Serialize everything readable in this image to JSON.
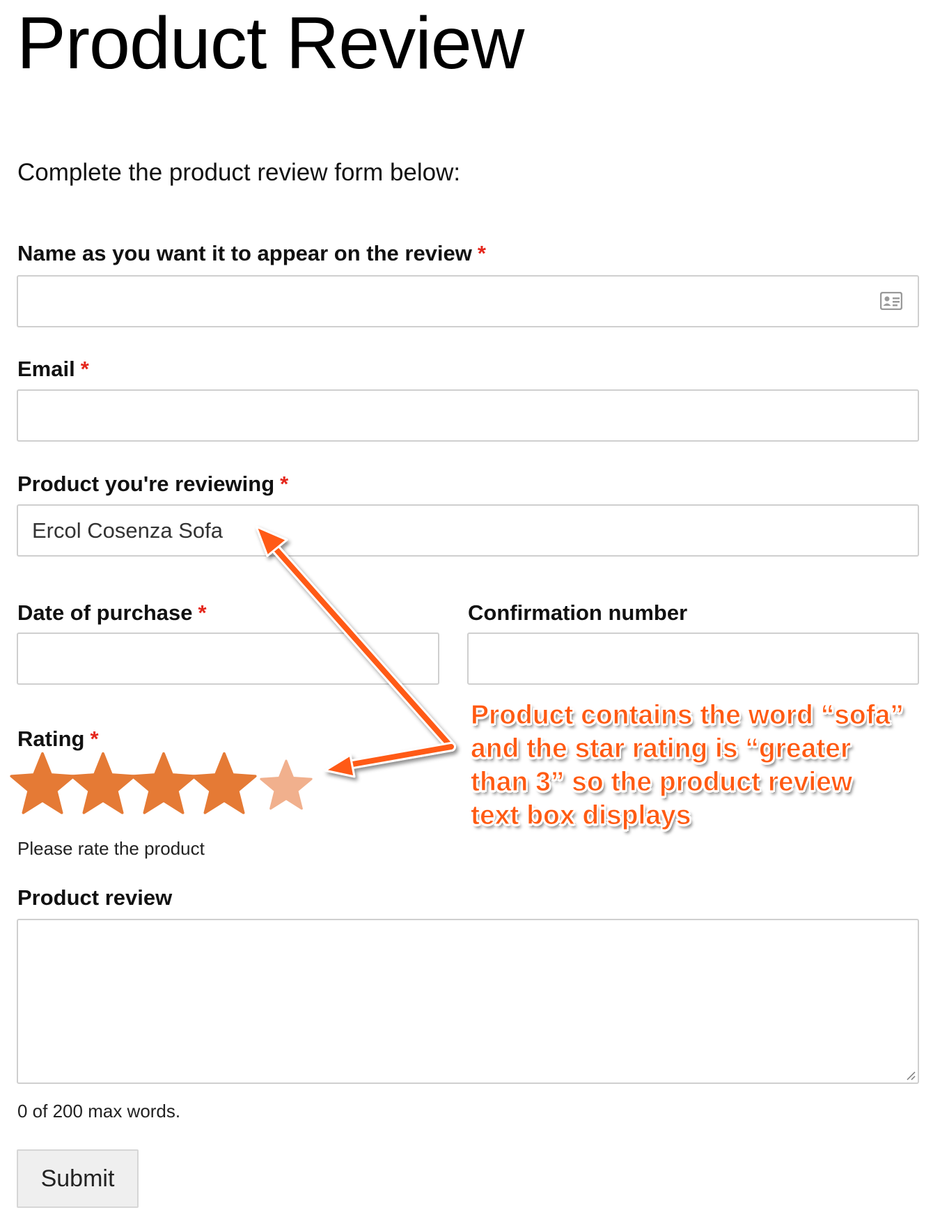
{
  "page": {
    "title": "Product Review",
    "intro": "Complete the product review form below:"
  },
  "form": {
    "required_marker": "*",
    "name": {
      "label": "Name as you want it to appear on the review",
      "value": "",
      "icon": "contact-card-icon"
    },
    "email": {
      "label": "Email",
      "value": ""
    },
    "product": {
      "label": "Product you're reviewing",
      "value": "Ercol Cosenza Sofa"
    },
    "date_of_purchase": {
      "label": "Date of purchase",
      "value": ""
    },
    "confirmation_number": {
      "label": "Confirmation number",
      "value": ""
    },
    "rating": {
      "label": "Rating",
      "selected": 4,
      "max": 5,
      "hint": "Please rate the product",
      "filled_color": "#e57a35",
      "hover_color": "#f1b08d"
    },
    "review": {
      "label": "Product review",
      "value": "",
      "word_count": "0 of 200 max words."
    },
    "submit_label": "Submit"
  },
  "annotation": {
    "lines": [
      "Product contains the word “sofa”",
      "and the star rating is “greater",
      "than 3” so the product review",
      "text box displays"
    ],
    "color": "#ff5a12"
  },
  "colors": {
    "required": "#e5271c",
    "field_border": "#cfcfcf",
    "button_bg": "#efefef"
  }
}
